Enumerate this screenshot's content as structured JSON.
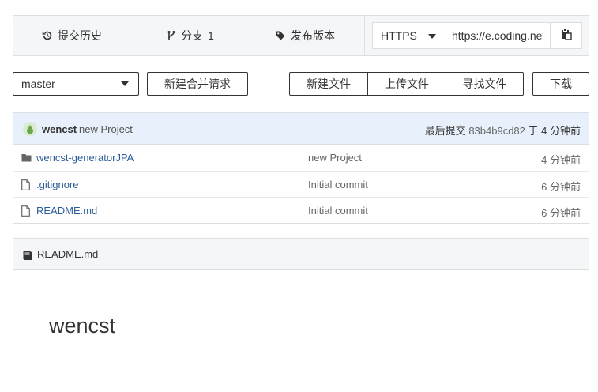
{
  "stats": {
    "history_label": "提交历史",
    "branches_label": "分支",
    "branches_count": "1",
    "releases_label": "发布版本"
  },
  "clone": {
    "protocol": "HTTPS",
    "url": "https://e.coding.net"
  },
  "actions": {
    "branch": "master",
    "merge_request": "新建合并请求",
    "new_file": "新建文件",
    "upload_file": "上传文件",
    "find_file": "寻找文件",
    "download": "下载"
  },
  "latest_commit": {
    "author": "wencst",
    "message": "new Project",
    "prefix": "最后提交",
    "hash": "83b4b9cd82",
    "at": "于",
    "time": "4 分钟前"
  },
  "files": [
    {
      "type": "folder",
      "name": "wencst-generatorJPA",
      "message": "new Project",
      "time": "4 分钟前"
    },
    {
      "type": "file",
      "name": ".gitignore",
      "message": "Initial commit",
      "time": "6 分钟前"
    },
    {
      "type": "file",
      "name": "README.md",
      "message": "Initial commit",
      "time": "6 分钟前"
    }
  ],
  "readme": {
    "filename": "README.md",
    "heading": "wencst"
  },
  "colors": {
    "link": "#2a5c9a",
    "commit_header_bg": "#e8f1fb",
    "panel_bg": "#f5f6f7",
    "border": "#dcdfe2"
  }
}
